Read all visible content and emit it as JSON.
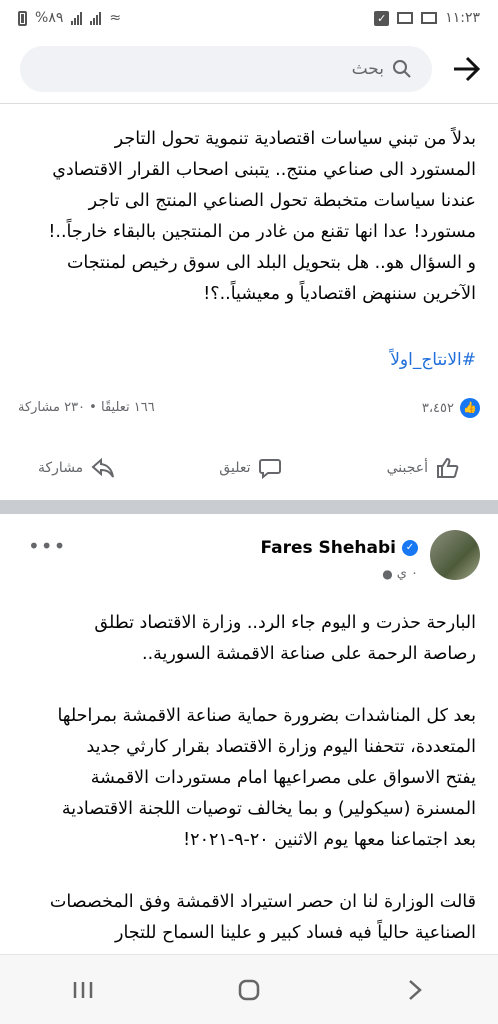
{
  "status": {
    "battery": "%٨٩",
    "time": "١١:٢٣"
  },
  "search": {
    "placeholder": "بحث"
  },
  "post1": {
    "text": "بدلاً من تبني سياسات اقتصادية تنموية تحول التاجر\nالمستورد الى صناعي منتج.. يتبنى اصحاب القرار الاقتصادي\nعندنا سياسات متخبطة تحول الصناعي المنتج الى تاجر\nمستورد! عدا انها تقنع من غادر من المنتجين بالبقاء خارجاً..!\nو السؤال هو.. هل بتحويل البلد الى سوق رخيص لمنتجات\nالآخرين سننهض اقتصادياً و معيشياً..؟!",
    "hashtag": "#الانتاج_اولاً",
    "reactions": "٣،٤٥٢",
    "comments_shares": "١٦٦ تعليقًا • ٢٣٠ مشاركة",
    "like_label": "أعجبني",
    "comment_label": "تعليق",
    "share_label": "مشاركة"
  },
  "post2": {
    "author": "Fares Shehabi",
    "time": "٠ ي",
    "text": "البارحة حذرت و اليوم جاء الرد.. وزارة الاقتصاد تطلق\nرصاصة الرحمة على صناعة الاقمشة السورية..\n\nبعد كل المناشدات بضرورة حماية صناعة الاقمشة بمراحلها\nالمتعددة، تتحفنا اليوم وزارة الاقتصاد بقرار كارثي جديد\nيفتح الاسواق على مصراعيها امام مستوردات الاقمشة\nالمسنرة (سيكولير) و بما يخالف توصيات اللجنة الاقتصادية\nبعد اجتماعنا معها يوم الاثنين ٢٠-٩-٢٠٢١!\n\nقالت الوزارة لنا ان حصر استيراد الاقمشة وفق المخصصات\nالصناعية حالياً فيه فساد كبير و علينا السماح للتجار"
  }
}
